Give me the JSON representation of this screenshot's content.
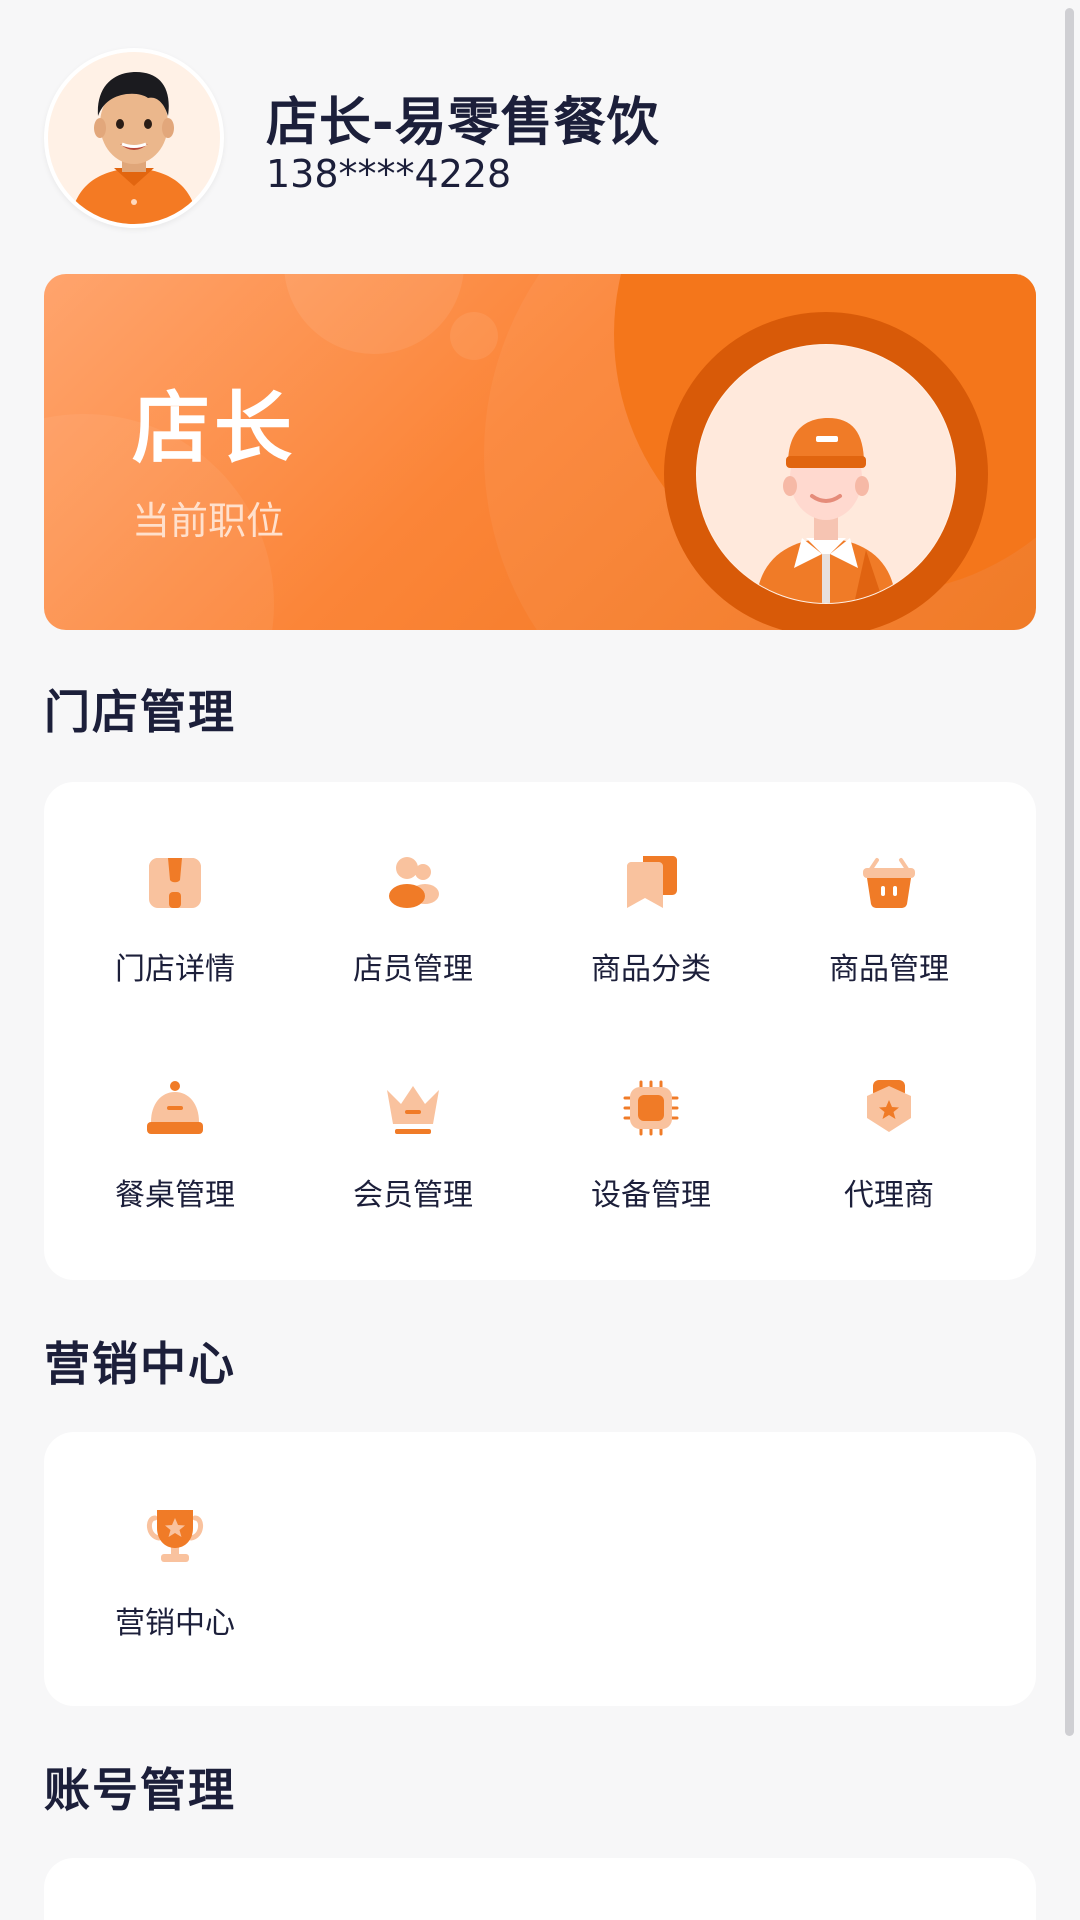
{
  "profile": {
    "name": "店长-易零售餐饮",
    "phone": "138****4228"
  },
  "role": {
    "title": "店长",
    "subtitle": "当前职位"
  },
  "store_management": {
    "title": "门店管理",
    "items": [
      {
        "label": "门店详情",
        "icon": "storefront-icon"
      },
      {
        "label": "店员管理",
        "icon": "staff-icon"
      },
      {
        "label": "商品分类",
        "icon": "category-icon"
      },
      {
        "label": "商品管理",
        "icon": "basket-icon"
      },
      {
        "label": "餐桌管理",
        "icon": "service-bell-icon"
      },
      {
        "label": "会员管理",
        "icon": "crown-icon"
      },
      {
        "label": "设备管理",
        "icon": "chip-icon"
      },
      {
        "label": "代理商",
        "icon": "agent-badge-icon"
      }
    ]
  },
  "marketing": {
    "title": "营销中心",
    "items": [
      {
        "label": "营销中心",
        "icon": "trophy-icon"
      }
    ]
  },
  "account": {
    "title": "账号管理"
  },
  "colors": {
    "accent": "#f47a23",
    "accent_light": "#f9c29e",
    "text": "#1c1f3a",
    "background": "#f7f7f8"
  }
}
